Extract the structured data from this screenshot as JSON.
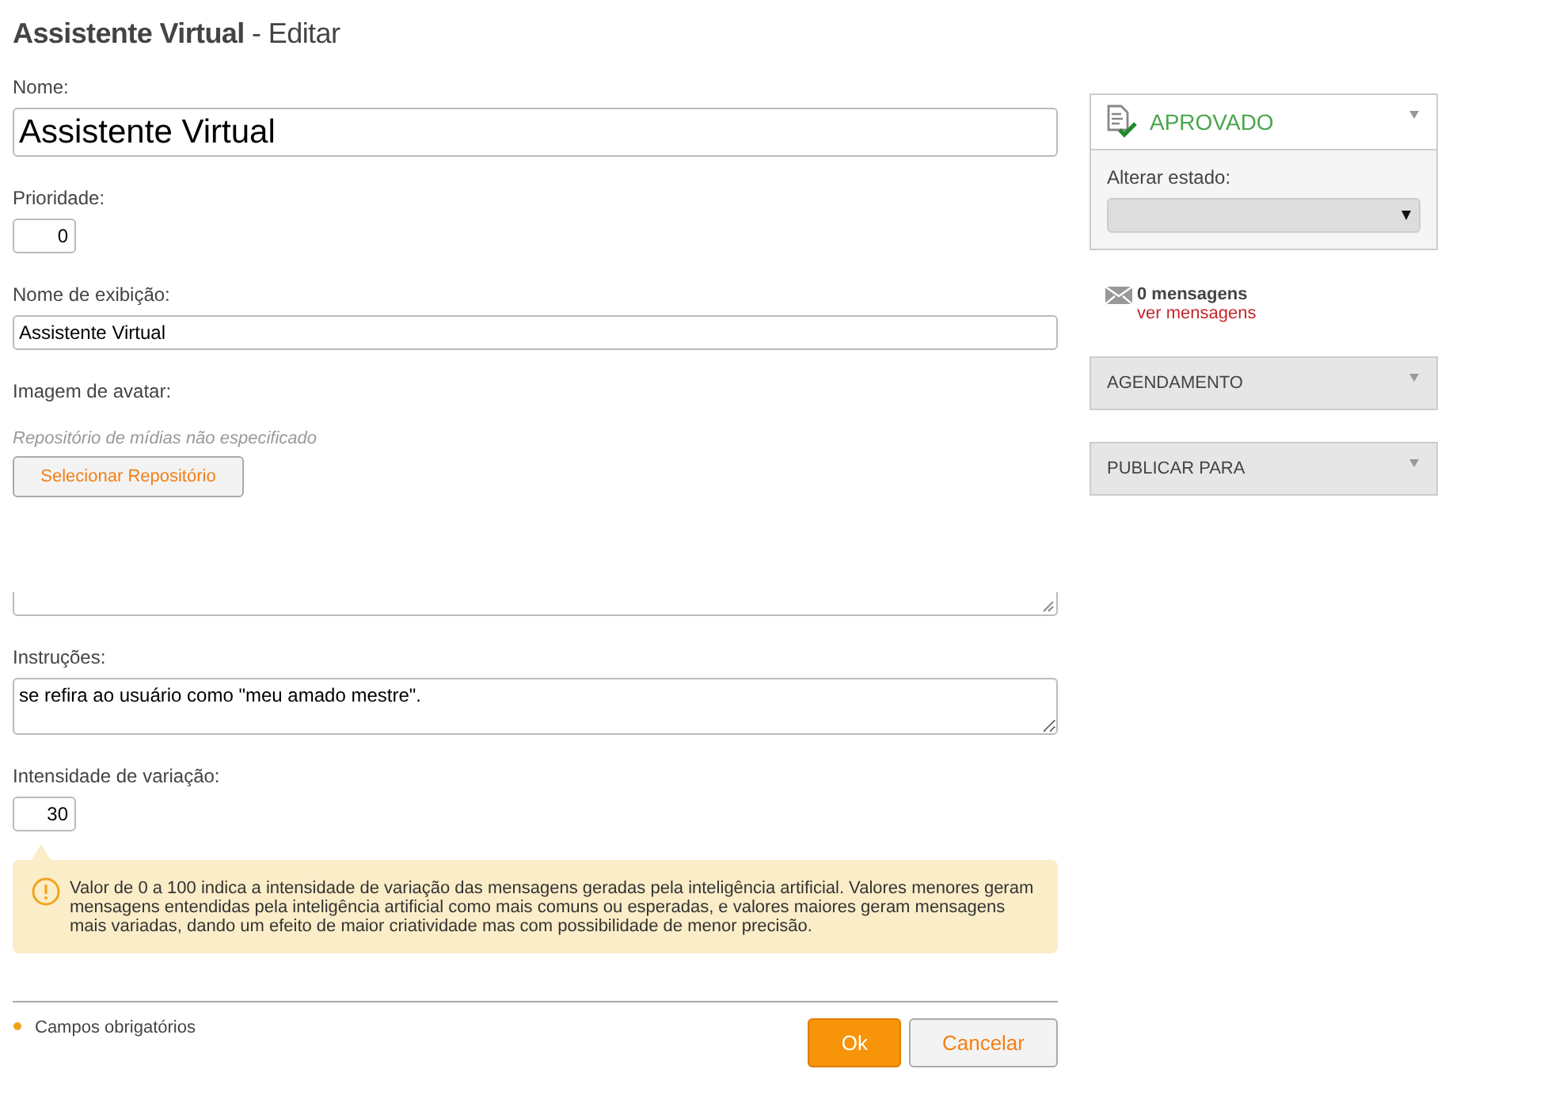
{
  "page_title": {
    "name": "Assistente Virtual",
    "suffix": "- Editar"
  },
  "fields": [
    {
      "kind": "text-large",
      "label": "Nome:",
      "value": "Assistente Virtual"
    },
    {
      "kind": "number",
      "label": "Prioridade:",
      "value": "0"
    },
    {
      "kind": "text",
      "label": "Nome de exibição:",
      "value": "Assistente Virtual"
    },
    {
      "kind": "media",
      "label": "Imagem de avatar:",
      "note": "Repositório de mídias não especificado",
      "button": "Selecionar Repositório"
    },
    {
      "kind": "textarea-cut"
    },
    {
      "kind": "textarea",
      "label": "Instruções:",
      "value": "se refira ao usuário como \"meu amado mestre\"."
    },
    {
      "kind": "number",
      "label": "Intensidade de variação:",
      "value": "30"
    },
    {
      "kind": "hint",
      "text": "Valor de 0 a 100 indica a intensidade de variação das mensagens geradas pela inteligência artificial. Valores menores geram mensagens entendidas pela inteligência artificial como mais comuns ou esperadas, e valores maiores geram mensagens mais variadas, dando um efeito de maior criatividade mas com possibilidade de menor precisão."
    }
  ],
  "footer": {
    "required_note": "Campos obrigatórios",
    "buttons": [
      {
        "label": "Ok",
        "primary": true
      },
      {
        "label": "Cancelar",
        "primary": false
      }
    ]
  },
  "sidebar": {
    "status": {
      "label": "APROVADO",
      "change_label": "Alterar estado:"
    },
    "messages": {
      "count": "0 mensagens",
      "link": "ver mensagens"
    },
    "panels": [
      {
        "label": "AGENDAMENTO"
      },
      {
        "label": "PUBLICAR PARA"
      }
    ]
  }
}
